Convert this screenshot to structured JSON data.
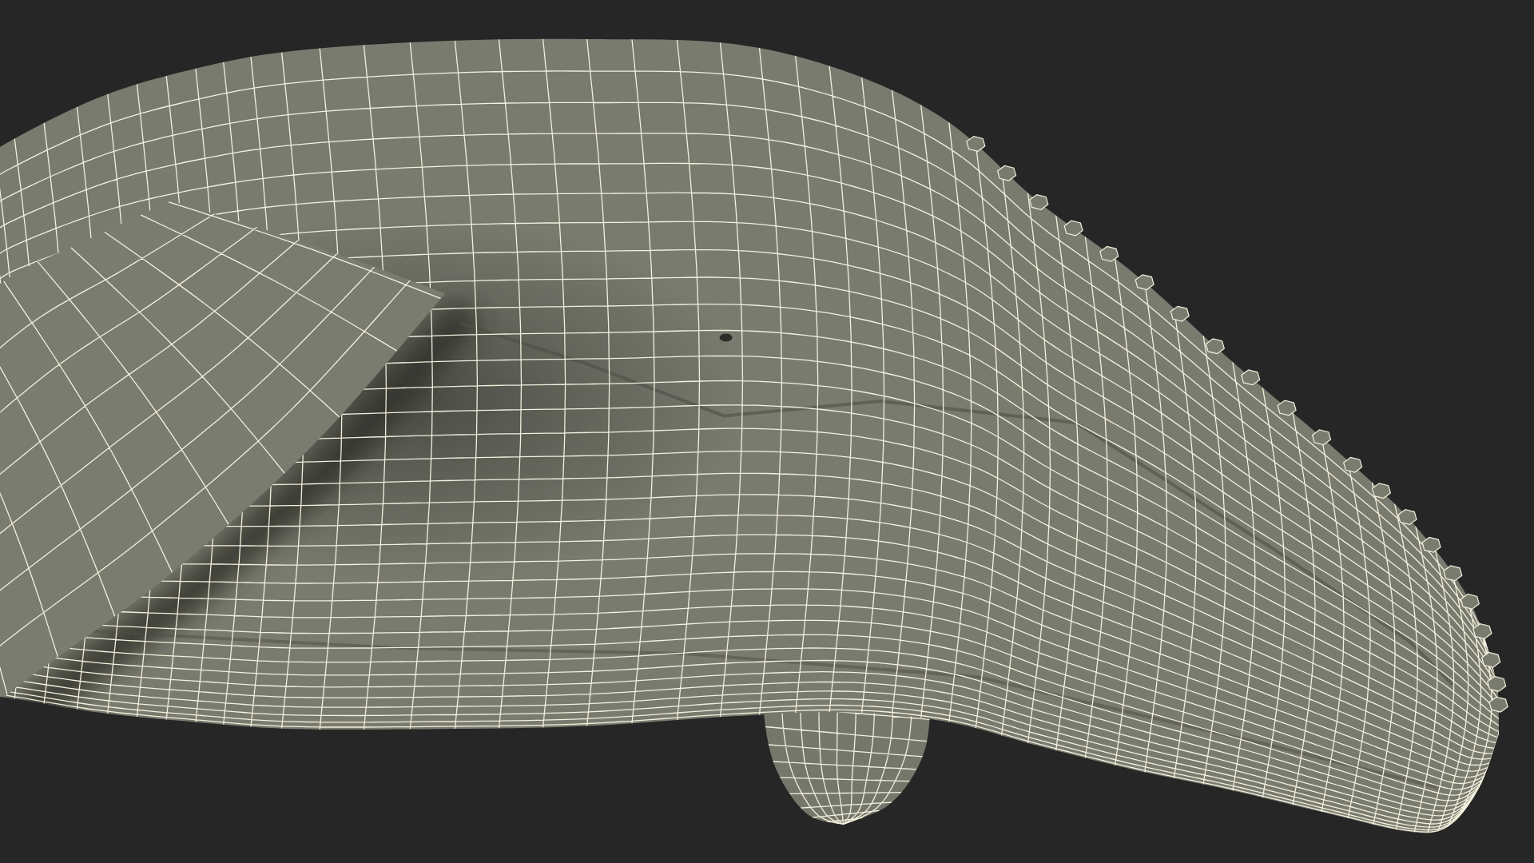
{
  "scene": {
    "wireframe": true
  }
}
